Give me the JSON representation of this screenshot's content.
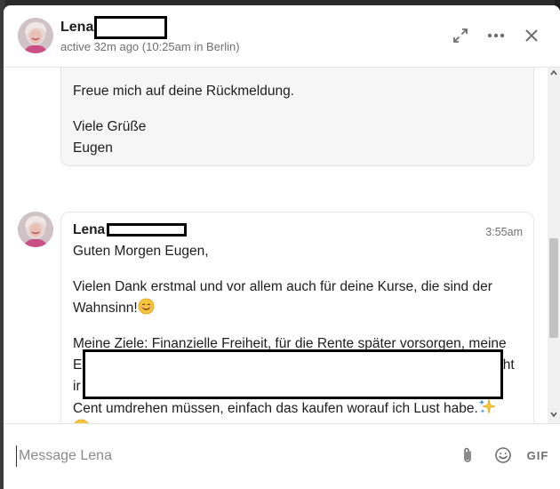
{
  "header": {
    "name": "Lena",
    "status": "active 32m ago (10:25am in Berlin)"
  },
  "message_1": {
    "line1": "Freue mich auf deine Rückmeldung.",
    "line2": "Viele Grüße",
    "line3": "Eugen"
  },
  "message_2": {
    "sender": "Lena",
    "time": "3:55am",
    "greeting": "Guten Morgen Eugen,",
    "para1_line1": "Vielen Dank erstmal und vor allem auch für deine Kurse, die sind der",
    "para1_line2": "Wahnsinn!",
    "para2_line1": "Meine Ziele: Finanzielle Freiheit, für die Rente später vorsorgen, meine",
    "para2_line2_start": "E",
    "para2_line2_end": "cht",
    "para2_line3_start": "ir",
    "para2_line4": "Cent umdrehen müssen, einfach das kaufen worauf ich Lust habe."
  },
  "composer": {
    "placeholder": "Message Lena",
    "gif_label": "GIF"
  },
  "icons": {
    "expand": "expand-icon",
    "more": "more-icon",
    "close": "close-icon",
    "attach": "paperclip-icon",
    "emoji": "smiley-icon"
  }
}
